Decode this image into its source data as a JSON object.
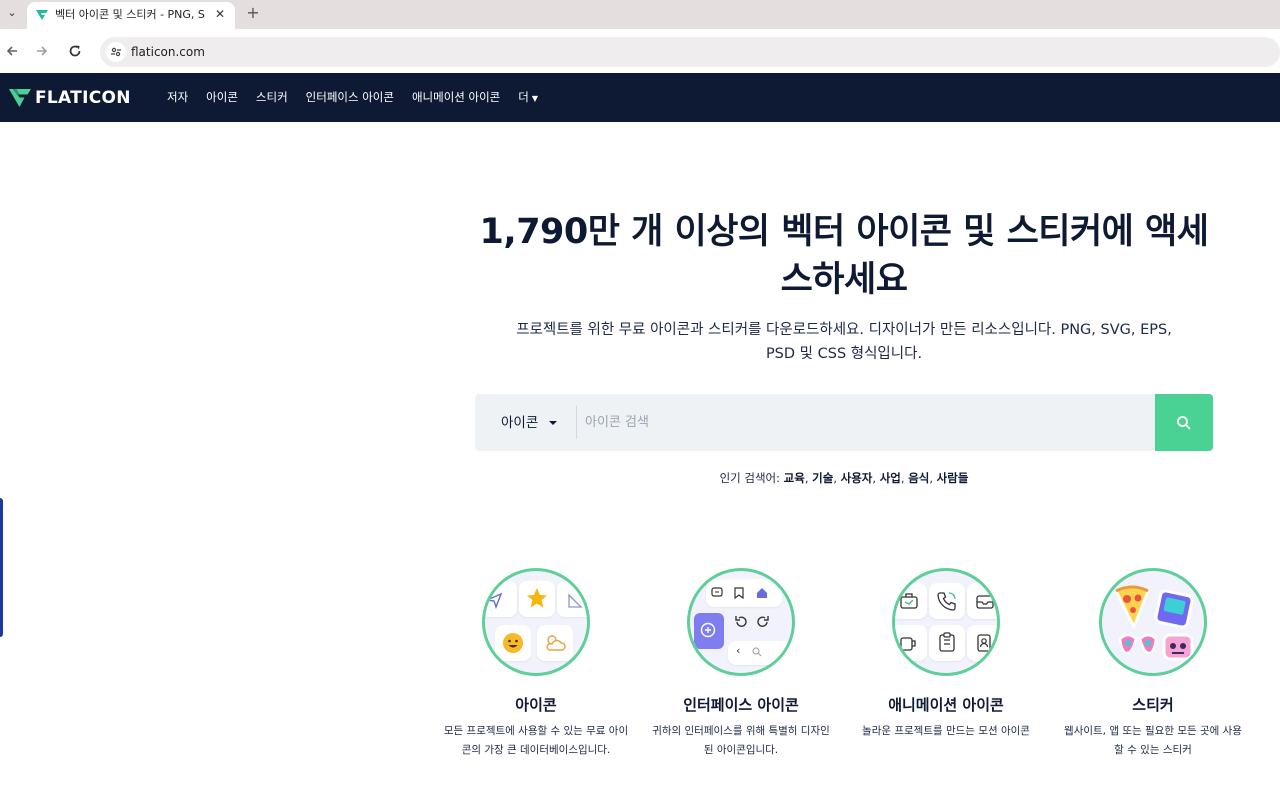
{
  "browser": {
    "tab_title": "벡터 아이콘 및 스티커 - PNG, S",
    "url": "flaticon.com",
    "tab_close": "✕",
    "new_tab": "+"
  },
  "header": {
    "logo_text": "FLATICON",
    "nav": [
      "저자",
      "아이콘",
      "스티커",
      "인터페이스 아이콘",
      "애니메이션 아이콘",
      "더"
    ]
  },
  "hero": {
    "title": "1,790만 개 이상의 벡터 아이콘 및 스티커에 액세스하세요",
    "subtitle": "프로젝트를 위한 무료 아이콘과 스티커를 다운로드하세요. 디자이너가 만든 리소스입니다. PNG, SVG, EPS, PSD 및 CSS 형식입니다."
  },
  "search": {
    "type_label": "아이콘",
    "placeholder": "아이콘 검색"
  },
  "popular": {
    "label": "인기 검색어:",
    "terms": [
      "교육",
      "기술",
      "사용자",
      "사업",
      "음식",
      "사람들"
    ]
  },
  "categories": [
    {
      "title": "아이콘",
      "desc": "모든 프로젝트에 사용할 수 있는 무료 아이콘의 가장 큰 데이터베이스입니다."
    },
    {
      "title": "인터페이스 아이콘",
      "desc": "귀하의 인터페이스를 위해 특별히 디자인된 아이콘입니다."
    },
    {
      "title": "애니메이션 아이콘",
      "desc": "놀라운 프로젝트를 만드는 모션 아이콘"
    },
    {
      "title": "스티커",
      "desc": "웹사이트, 앱 또는 필요한 모든 곳에 사용할 수 있는 스티커"
    }
  ],
  "colors": {
    "header_bg": "#0e1a33",
    "accent": "#4ad295"
  }
}
